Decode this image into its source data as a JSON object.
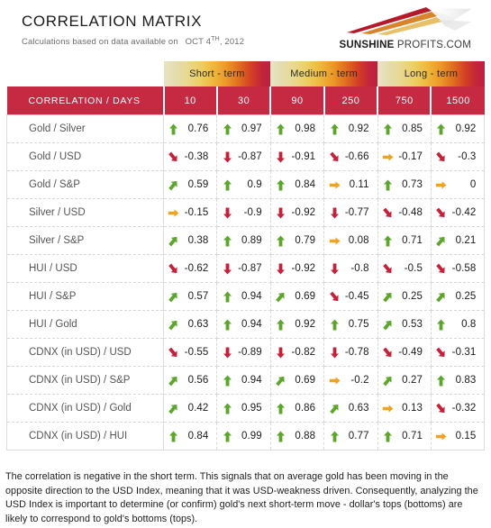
{
  "header": {
    "title": "CORRELATION MATRIX",
    "subtitle_prefix": "Calculations based on data available on",
    "subtitle_date_main": "OCT 4",
    "subtitle_date_sup": "TH",
    "subtitle_date_year": ", 2012",
    "subtitle_full": "Calculations based on data available on  OCT 4TH, 2012",
    "logo_bold": "SUNSHINE",
    "logo_normal": " PROFITS.COM"
  },
  "colors": {
    "header_red": "#c52a42",
    "positive_green": "#5da62c",
    "negative_red": "#c5213a",
    "neutral_orange": "#f0a31e",
    "gradient_start": "#e8e3c4",
    "gradient_mid": "#efb93c",
    "gradient_end": "#bb2040"
  },
  "table": {
    "term_bands": [
      {
        "label": "Short - term",
        "span": 2
      },
      {
        "label": "Medium - term",
        "span": 2
      },
      {
        "label": "Long - term",
        "span": 2
      }
    ],
    "corner_label": "CORRELATION / DAYS",
    "day_headers": [
      "10",
      "30",
      "90",
      "250",
      "750",
      "1500"
    ],
    "rows": [
      {
        "label": "Gold / Silver",
        "cells": [
          {
            "value": "0.76",
            "arrow": "up-arrow-icon"
          },
          {
            "value": "0.97",
            "arrow": "up-arrow-icon"
          },
          {
            "value": "0.98",
            "arrow": "up-arrow-icon"
          },
          {
            "value": "0.92",
            "arrow": "up-arrow-icon"
          },
          {
            "value": "0.85",
            "arrow": "up-arrow-icon"
          },
          {
            "value": "0.92",
            "arrow": "up-arrow-icon"
          }
        ]
      },
      {
        "label": "Gold / USD",
        "cells": [
          {
            "value": "-0.38",
            "arrow": "down-right-arrow-icon"
          },
          {
            "value": "-0.87",
            "arrow": "down-arrow-icon"
          },
          {
            "value": "-0.91",
            "arrow": "down-arrow-icon"
          },
          {
            "value": "-0.66",
            "arrow": "down-right-arrow-icon"
          },
          {
            "value": "-0.17",
            "arrow": "right-arrow-icon"
          },
          {
            "value": "-0.3",
            "arrow": "down-right-arrow-icon"
          }
        ]
      },
      {
        "label": "Gold / S&P",
        "cells": [
          {
            "value": "0.59",
            "arrow": "up-right-arrow-icon"
          },
          {
            "value": "0.9",
            "arrow": "up-arrow-icon"
          },
          {
            "value": "0.84",
            "arrow": "up-arrow-icon"
          },
          {
            "value": "0.11",
            "arrow": "right-arrow-icon"
          },
          {
            "value": "0.73",
            "arrow": "up-arrow-icon"
          },
          {
            "value": "0",
            "arrow": "right-arrow-icon"
          }
        ]
      },
      {
        "label": "Silver / USD",
        "cells": [
          {
            "value": "-0.15",
            "arrow": "right-arrow-icon"
          },
          {
            "value": "-0.9",
            "arrow": "down-arrow-icon"
          },
          {
            "value": "-0.92",
            "arrow": "down-arrow-icon"
          },
          {
            "value": "-0.77",
            "arrow": "down-arrow-icon"
          },
          {
            "value": "-0.48",
            "arrow": "down-right-arrow-icon"
          },
          {
            "value": "-0.42",
            "arrow": "down-right-arrow-icon"
          }
        ]
      },
      {
        "label": "Silver / S&P",
        "cells": [
          {
            "value": "0.38",
            "arrow": "up-right-arrow-icon"
          },
          {
            "value": "0.89",
            "arrow": "up-arrow-icon"
          },
          {
            "value": "0.79",
            "arrow": "up-arrow-icon"
          },
          {
            "value": "0.08",
            "arrow": "right-arrow-icon"
          },
          {
            "value": "0.71",
            "arrow": "up-arrow-icon"
          },
          {
            "value": "0.21",
            "arrow": "up-right-arrow-icon"
          }
        ]
      },
      {
        "label": "HUI / USD",
        "cells": [
          {
            "value": "-0.62",
            "arrow": "down-right-arrow-icon"
          },
          {
            "value": "-0.87",
            "arrow": "down-arrow-icon"
          },
          {
            "value": "-0.92",
            "arrow": "down-arrow-icon"
          },
          {
            "value": "-0.8",
            "arrow": "down-arrow-icon"
          },
          {
            "value": "-0.5",
            "arrow": "down-right-arrow-icon"
          },
          {
            "value": "-0.58",
            "arrow": "down-right-arrow-icon"
          }
        ]
      },
      {
        "label": "HUI / S&P",
        "cells": [
          {
            "value": "0.57",
            "arrow": "up-right-arrow-icon"
          },
          {
            "value": "0.94",
            "arrow": "up-arrow-icon"
          },
          {
            "value": "0.69",
            "arrow": "up-right-arrow-icon"
          },
          {
            "value": "-0.45",
            "arrow": "down-right-arrow-icon"
          },
          {
            "value": "0.25",
            "arrow": "up-right-arrow-icon"
          },
          {
            "value": "0.25",
            "arrow": "up-right-arrow-icon"
          }
        ]
      },
      {
        "label": "HUI / Gold",
        "cells": [
          {
            "value": "0.63",
            "arrow": "up-right-arrow-icon"
          },
          {
            "value": "0.94",
            "arrow": "up-arrow-icon"
          },
          {
            "value": "0.92",
            "arrow": "up-arrow-icon"
          },
          {
            "value": "0.75",
            "arrow": "up-arrow-icon"
          },
          {
            "value": "0.53",
            "arrow": "up-right-arrow-icon"
          },
          {
            "value": "0.8",
            "arrow": "up-arrow-icon"
          }
        ]
      },
      {
        "label": "CDNX (in USD) / USD",
        "cells": [
          {
            "value": "-0.55",
            "arrow": "down-right-arrow-icon"
          },
          {
            "value": "-0.89",
            "arrow": "down-arrow-icon"
          },
          {
            "value": "-0.82",
            "arrow": "down-arrow-icon"
          },
          {
            "value": "-0.78",
            "arrow": "down-arrow-icon"
          },
          {
            "value": "-0.49",
            "arrow": "down-right-arrow-icon"
          },
          {
            "value": "-0.31",
            "arrow": "down-right-arrow-icon"
          }
        ]
      },
      {
        "label": "CDNX (in USD) / S&P",
        "cells": [
          {
            "value": "0.56",
            "arrow": "up-right-arrow-icon"
          },
          {
            "value": "0.94",
            "arrow": "up-arrow-icon"
          },
          {
            "value": "0.69",
            "arrow": "up-right-arrow-icon"
          },
          {
            "value": "-0.2",
            "arrow": "right-arrow-icon"
          },
          {
            "value": "0.27",
            "arrow": "up-right-arrow-icon"
          },
          {
            "value": "0.83",
            "arrow": "up-arrow-icon"
          }
        ]
      },
      {
        "label": "CDNX (in USD) / Gold",
        "cells": [
          {
            "value": "0.42",
            "arrow": "up-right-arrow-icon"
          },
          {
            "value": "0.95",
            "arrow": "up-arrow-icon"
          },
          {
            "value": "0.86",
            "arrow": "up-arrow-icon"
          },
          {
            "value": "0.63",
            "arrow": "up-right-arrow-icon"
          },
          {
            "value": "0.13",
            "arrow": "right-arrow-icon"
          },
          {
            "value": "-0.32",
            "arrow": "down-right-arrow-icon"
          }
        ]
      },
      {
        "label": "CDNX (in USD) / HUI",
        "cells": [
          {
            "value": "0.84",
            "arrow": "up-arrow-icon"
          },
          {
            "value": "0.99",
            "arrow": "up-arrow-icon"
          },
          {
            "value": "0.88",
            "arrow": "up-arrow-icon"
          },
          {
            "value": "0.77",
            "arrow": "up-arrow-icon"
          },
          {
            "value": "0.71",
            "arrow": "up-arrow-icon"
          },
          {
            "value": "0.15",
            "arrow": "right-arrow-icon"
          }
        ]
      }
    ]
  },
  "caption": {
    "text": "The correlation is negative in the short term. This signals that on average gold has been moving in the opposite direction to the USD Index, meaning that it was USD-weakness driven. Consequently, analyzing the USD Index is important to determine (or confirm) gold's next short-term move - dollar's tops (bottoms) are likely to correspond to gold's bottoms (tops)."
  }
}
